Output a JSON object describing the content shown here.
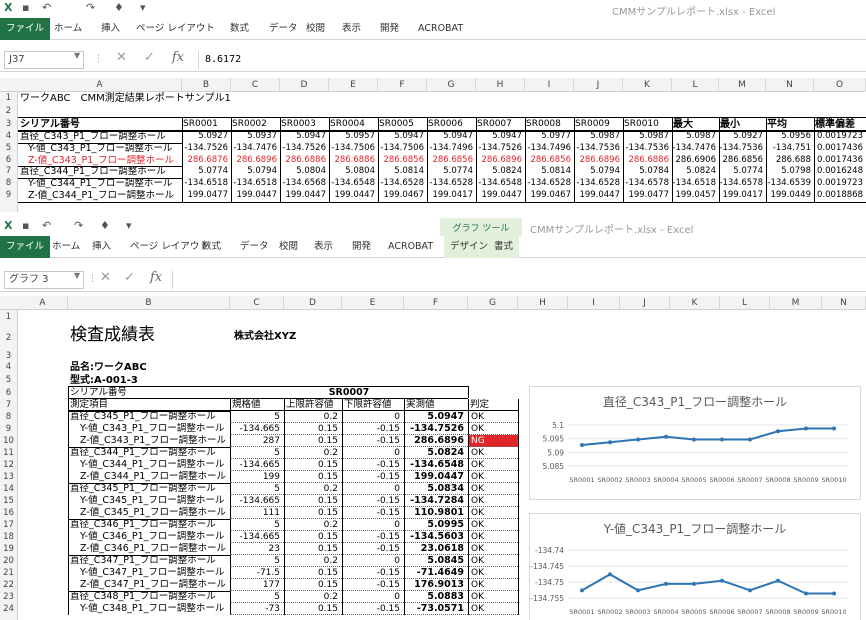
{
  "window1": {
    "title": "CMMサンプルレポート.xlsx - Excel",
    "tabs": [
      "ファイル",
      "ホーム",
      "挿入",
      "ページ レイアウト",
      "数式",
      "データ",
      "校閲",
      "表示",
      "開発",
      "ACROBAT"
    ],
    "name_box": "J37",
    "formula": "8.6172",
    "columns": [
      "A",
      "B",
      "C",
      "D",
      "E",
      "F",
      "G",
      "H",
      "I",
      "J",
      "K",
      "L",
      "M",
      "N",
      "O"
    ],
    "rows": [
      "1",
      "2",
      "3",
      "4",
      "5",
      "6",
      "7",
      "8",
      "9"
    ],
    "sheet_title": "ワークABC　CMM測定結果レポートサンプル1",
    "header_label": "シリアル番号",
    "serials": [
      "SR0001",
      "SR0002",
      "SR0003",
      "SR0004",
      "SR0005",
      "SR0006",
      "SR0007",
      "SR0008",
      "SR0009",
      "SR0010"
    ],
    "stat_headers": [
      "最大",
      "最小",
      "平均",
      "標準偏差"
    ],
    "data_rows": [
      {
        "name": "直径_C343_P1_フロー調整ホール",
        "vals": [
          "5.0927",
          "5.0937",
          "5.0947",
          "5.0957",
          "5.0947",
          "5.0947",
          "5.0947",
          "5.0977",
          "5.0987",
          "5.0987",
          "5.0987",
          "5.0927",
          "5.0956",
          "0.0019723"
        ],
        "red": false,
        "indent": false,
        "framed": true
      },
      {
        "name": "Y-値_C343_P1_フロー調整ホール",
        "vals": [
          "-134.7526",
          "-134.7476",
          "-134.7526",
          "-134.7506",
          "-134.7506",
          "-134.7496",
          "-134.7526",
          "-134.7496",
          "-134.7536",
          "-134.7536",
          "-134.7476",
          "-134.7536",
          "-134.751",
          "0.0017436"
        ],
        "red": false,
        "indent": true,
        "framed": false
      },
      {
        "name": "Z-値_C343_P1_フロー調整ホール",
        "vals": [
          "286.6876",
          "286.6896",
          "286.6886",
          "286.6886",
          "286.6856",
          "286.6856",
          "286.6896",
          "286.6856",
          "286.6896",
          "286.6886",
          "286.6906",
          "286.6856",
          "286.688",
          "0.0017436"
        ],
        "red": true,
        "indent": true,
        "framed": false
      },
      {
        "name": "直径_C344_P1_フロー調整ホール",
        "vals": [
          "5.0774",
          "5.0794",
          "5.0804",
          "5.0804",
          "5.0814",
          "5.0774",
          "5.0824",
          "5.0814",
          "5.0794",
          "5.0784",
          "5.0824",
          "5.0774",
          "5.0798",
          "0.0016248"
        ],
        "red": false,
        "indent": false,
        "framed": true
      },
      {
        "name": "Y-値_C344_P1_フロー調整ホール",
        "vals": [
          "-134.6518",
          "-134.6518",
          "-134.6568",
          "-134.6548",
          "-134.6528",
          "-134.6528",
          "-134.6548",
          "-134.6528",
          "-134.6528",
          "-134.6578",
          "-134.6518",
          "-134.6578",
          "-134.6539",
          "0.0019723"
        ],
        "red": false,
        "indent": true,
        "framed": false
      },
      {
        "name": "Z-値_C344_P1_フロー調整ホール",
        "vals": [
          "199.0477",
          "199.0447",
          "199.0447",
          "199.0447",
          "199.0467",
          "199.0417",
          "199.0447",
          "199.0467",
          "199.0447",
          "199.0477",
          "199.0457",
          "199.0417",
          "199.0449",
          "0.0018868"
        ],
        "red": false,
        "indent": true,
        "framed": false
      }
    ]
  },
  "window2": {
    "title": "CMMサンプルレポート.xlsx - Excel",
    "tool_group": "グラフ ツール",
    "tabs": [
      "ファイル",
      "ホーム",
      "挿入",
      "ページ レイアウト",
      "数式",
      "データ",
      "校閲",
      "表示",
      "開発",
      "ACROBAT",
      "デザイン",
      "書式"
    ],
    "name_box": "グラフ 3",
    "formula": "",
    "columns": [
      "A",
      "B",
      "C",
      "D",
      "E",
      "F",
      "G",
      "H",
      "I",
      "J",
      "K",
      "L",
      "M",
      "N"
    ],
    "rows": [
      "1",
      "2",
      "3",
      "4",
      "5",
      "6",
      "7",
      "8",
      "9",
      "10",
      "11",
      "12",
      "13",
      "14",
      "15",
      "16",
      "17",
      "18",
      "19",
      "20",
      "21",
      "22",
      "23",
      "24"
    ],
    "report_title": "検査成績表",
    "company": "株式会社XYZ",
    "part_name": "品名:ワークABC",
    "model": "型式:A-001-3",
    "serial_label": "シリアル番号",
    "serial_value": "SR0007",
    "headers": [
      "測定項目",
      "規格値",
      "上限許容値",
      "下限許容値",
      "実測値",
      "判定"
    ],
    "rows_data": [
      {
        "item": "直径_C345_P1_フロー調整ホール",
        "spec": "5",
        "up": "0.2",
        "lo": "0",
        "meas": "5.0947",
        "judge": "OK",
        "indent": false,
        "ng": false
      },
      {
        "item": "Y-値_C343_P1_フロー調整ホール",
        "spec": "-134.665",
        "up": "0.15",
        "lo": "-0.15",
        "meas": "-134.7526",
        "judge": "OK",
        "indent": true,
        "ng": false
      },
      {
        "item": "Z-値_C343_P1_フロー調整ホール",
        "spec": "287",
        "up": "0.15",
        "lo": "-0.15",
        "meas": "286.6896",
        "judge": "NG",
        "indent": true,
        "ng": true
      },
      {
        "item": "直径_C344_P1_フロー調整ホール",
        "spec": "5",
        "up": "0.2",
        "lo": "0",
        "meas": "5.0824",
        "judge": "OK",
        "indent": false,
        "ng": false
      },
      {
        "item": "Y-値_C344_P1_フロー調整ホール",
        "spec": "-134.665",
        "up": "0.15",
        "lo": "-0.15",
        "meas": "-134.6548",
        "judge": "OK",
        "indent": true,
        "ng": false
      },
      {
        "item": "Z-値_C344_P1_フロー調整ホール",
        "spec": "199",
        "up": "0.15",
        "lo": "-0.15",
        "meas": "199.0447",
        "judge": "OK",
        "indent": true,
        "ng": false
      },
      {
        "item": "直径_C345_P1_フロー調整ホール",
        "spec": "5",
        "up": "0.2",
        "lo": "0",
        "meas": "5.0834",
        "judge": "OK",
        "indent": false,
        "ng": false
      },
      {
        "item": "Y-値_C345_P1_フロー調整ホール",
        "spec": "-134.665",
        "up": "0.15",
        "lo": "-0.15",
        "meas": "-134.7284",
        "judge": "OK",
        "indent": true,
        "ng": false
      },
      {
        "item": "Z-値_C345_P1_フロー調整ホール",
        "spec": "111",
        "up": "0.15",
        "lo": "-0.15",
        "meas": "110.9801",
        "judge": "OK",
        "indent": true,
        "ng": false
      },
      {
        "item": "直径_C346_P1_フロー調整ホール",
        "spec": "5",
        "up": "0.2",
        "lo": "0",
        "meas": "5.0995",
        "judge": "OK",
        "indent": false,
        "ng": false
      },
      {
        "item": "Y-値_C346_P1_フロー調整ホール",
        "spec": "-134.665",
        "up": "0.15",
        "lo": "-0.15",
        "meas": "-134.5603",
        "judge": "OK",
        "indent": true,
        "ng": false
      },
      {
        "item": "Z-値_C346_P1_フロー調整ホール",
        "spec": "23",
        "up": "0.15",
        "lo": "-0.15",
        "meas": "23.0618",
        "judge": "OK",
        "indent": true,
        "ng": false
      },
      {
        "item": "直径_C347_P1_フロー調整ホール",
        "spec": "5",
        "up": "0.2",
        "lo": "0",
        "meas": "5.0845",
        "judge": "OK",
        "indent": false,
        "ng": false
      },
      {
        "item": "Y-値_C347_P1_フロー調整ホール",
        "spec": "-71.5",
        "up": "0.15",
        "lo": "-0.15",
        "meas": "-71.4649",
        "judge": "OK",
        "indent": true,
        "ng": false
      },
      {
        "item": "Z-値_C347_P1_フロー調整ホール",
        "spec": "177",
        "up": "0.15",
        "lo": "-0.15",
        "meas": "176.9013",
        "judge": "OK",
        "indent": true,
        "ng": false
      },
      {
        "item": "直径_C348_P1_フロー調整ホール",
        "spec": "5",
        "up": "0.2",
        "lo": "0",
        "meas": "5.0883",
        "judge": "OK",
        "indent": false,
        "ng": false
      },
      {
        "item": "Y-値_C348_P1_フロー調整ホール",
        "spec": "-73",
        "up": "0.15",
        "lo": "-0.15",
        "meas": "-73.0571",
        "judge": "OK",
        "indent": true,
        "ng": false
      }
    ]
  },
  "colors": {
    "excel_green": "#217346",
    "chart_line": "#2e75b6",
    "ng_red": "#e0262b",
    "tool_green": "#e2efda"
  },
  "chart_data": [
    {
      "type": "line",
      "title": "直径_C343_P1_フロー調整ホール",
      "categories": [
        "SR0001",
        "SR0002",
        "SR0003",
        "SR0004",
        "SR0005",
        "SR0006",
        "SR0007",
        "SR0008",
        "SR0009",
        "SR0010"
      ],
      "values": [
        5.0927,
        5.0937,
        5.0947,
        5.0957,
        5.0947,
        5.0947,
        5.0947,
        5.0977,
        5.0987,
        5.0987
      ],
      "yticks": [
        "5.1",
        "5.095",
        "5.09",
        "5.085"
      ],
      "ylim": [
        5.085,
        5.1
      ]
    },
    {
      "type": "line",
      "title": "Y-値_C343_P1_フロー調整ホール",
      "categories": [
        "SR0001",
        "SR0002",
        "SR0003",
        "SR0004",
        "SR0005",
        "SR0006",
        "SR0007",
        "SR0008",
        "SR0009",
        "SR0010"
      ],
      "values": [
        -134.7526,
        -134.7476,
        -134.7526,
        -134.7506,
        -134.7506,
        -134.7496,
        -134.7526,
        -134.7496,
        -134.7536,
        -134.7536
      ],
      "yticks": [
        "-134.74",
        "-134.745",
        "-134.75",
        "-134.755"
      ],
      "ylim": [
        -134.755,
        -134.74
      ]
    }
  ]
}
